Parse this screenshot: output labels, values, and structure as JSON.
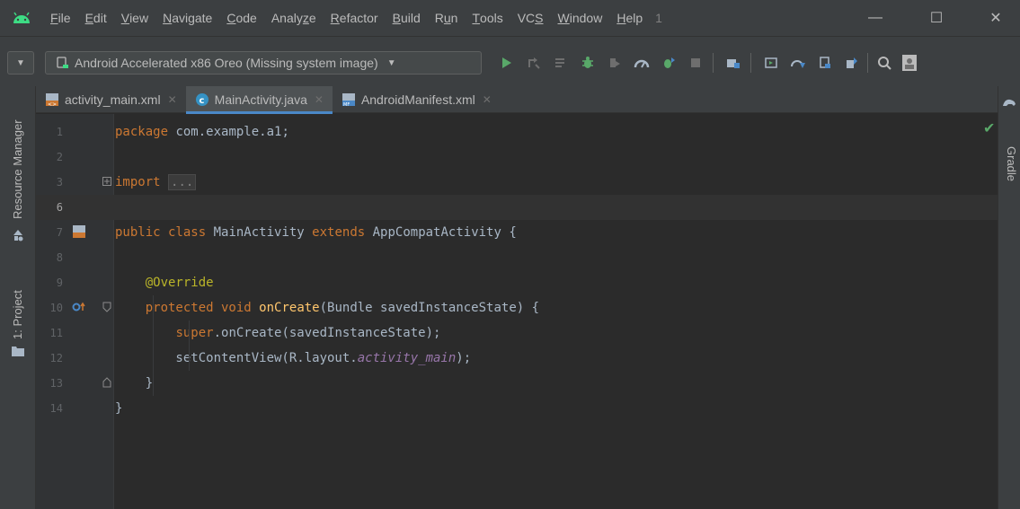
{
  "menu": {
    "items": [
      {
        "pre": "",
        "mn": "F",
        "post": "ile"
      },
      {
        "pre": "",
        "mn": "E",
        "post": "dit"
      },
      {
        "pre": "",
        "mn": "V",
        "post": "iew"
      },
      {
        "pre": "",
        "mn": "N",
        "post": "avigate"
      },
      {
        "pre": "",
        "mn": "C",
        "post": "ode"
      },
      {
        "pre": "Analy",
        "mn": "z",
        "post": "e"
      },
      {
        "pre": "",
        "mn": "R",
        "post": "efactor"
      },
      {
        "pre": "",
        "mn": "B",
        "post": "uild"
      },
      {
        "pre": "R",
        "mn": "u",
        "post": "n"
      },
      {
        "pre": "",
        "mn": "T",
        "post": "ools"
      },
      {
        "pre": "VC",
        "mn": "S",
        "post": ""
      },
      {
        "pre": "",
        "mn": "W",
        "post": "indow"
      },
      {
        "pre": "",
        "mn": "H",
        "post": "elp"
      }
    ],
    "badge": "1",
    "minimize": "—",
    "maximize": "☐",
    "close": "✕"
  },
  "toolbar": {
    "device_label": "Android Accelerated x86 Oreo (Missing system image)",
    "icons": [
      "run-icon",
      "apply-changes-icon",
      "apply-code-changes-icon",
      "debug-icon",
      "attach-debugger-icon",
      "profile-icon",
      "attach-process-icon",
      "stop-icon",
      "sync-gradle-icon",
      "avd-manager-icon",
      "sdk-manager-icon",
      "device-file-icon",
      "layout-inspector-icon",
      "search-icon"
    ]
  },
  "left_strip": {
    "resource_manager": "Resource Manager",
    "project": "1: Project"
  },
  "right_strip": {
    "gradle": "Gradle"
  },
  "tabs": [
    {
      "label": "activity_main.xml",
      "icon": "xml-file-icon",
      "active": false
    },
    {
      "label": "MainActivity.java",
      "icon": "java-class-icon",
      "active": true
    },
    {
      "label": "AndroidManifest.xml",
      "icon": "manifest-file-icon",
      "active": false
    }
  ],
  "editor": {
    "current_line": 6,
    "lines": [
      {
        "n": "1",
        "parts": [
          [
            "kw",
            "package"
          ],
          [
            "",
            " com.example.a1;"
          ]
        ]
      },
      {
        "n": "2",
        "parts": []
      },
      {
        "n": "3",
        "parts": [
          [
            "kw",
            "import"
          ],
          [
            "",
            " "
          ],
          [
            "fold",
            "..."
          ]
        ]
      },
      {
        "n": "6",
        "parts": []
      },
      {
        "n": "7",
        "parts": [
          [
            "kw",
            "public class"
          ],
          [
            "",
            " MainActivity "
          ],
          [
            "kw",
            "extends"
          ],
          [
            "",
            " AppCompatActivity {"
          ]
        ]
      },
      {
        "n": "8",
        "parts": []
      },
      {
        "n": "9",
        "parts": [
          [
            "",
            "    "
          ],
          [
            "ann",
            "@Override"
          ]
        ]
      },
      {
        "n": "10",
        "parts": [
          [
            "",
            "    "
          ],
          [
            "kw",
            "protected void"
          ],
          [
            "",
            " "
          ],
          [
            "fn",
            "onCreate"
          ],
          [
            "",
            "(Bundle savedInstanceState) {"
          ]
        ]
      },
      {
        "n": "11",
        "parts": [
          [
            "",
            "        "
          ],
          [
            "kw",
            "super"
          ],
          [
            "",
            ".onCreate(savedInstanceState);"
          ]
        ]
      },
      {
        "n": "12",
        "parts": [
          [
            "",
            "        setContentView(R.layout."
          ],
          [
            "fld",
            "activity_main"
          ],
          [
            "",
            ");"
          ]
        ]
      },
      {
        "n": "13",
        "parts": [
          [
            "",
            "    }"
          ]
        ]
      },
      {
        "n": "14",
        "parts": [
          [
            "",
            "}"
          ]
        ]
      }
    ]
  },
  "colors": {
    "background": "#2b2b2b",
    "chrome": "#3c3f41",
    "keyword": "#cc7832",
    "annotation": "#bbb529",
    "method": "#ffc66d",
    "field": "#9876aa",
    "accent": "#4a88c7",
    "run_green": "#59a869"
  }
}
